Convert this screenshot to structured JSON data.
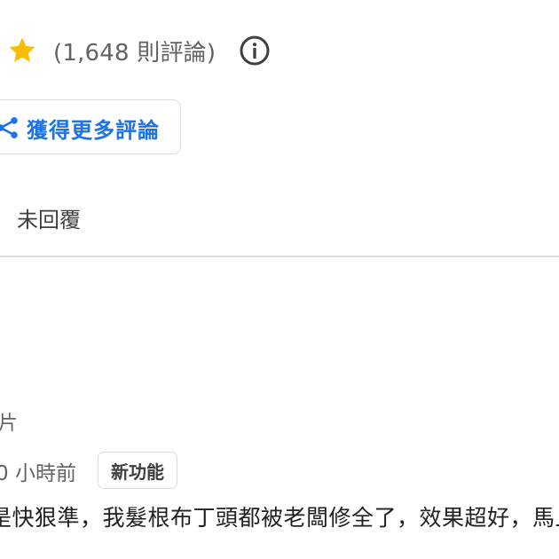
{
  "rating": {
    "review_count": "(1,648 則評論)",
    "star_color": "#fbbc04"
  },
  "actions": {
    "more_reviews_label": "獲得更多評論",
    "accent_color": "#1a73e8",
    "icon": "share-icon"
  },
  "filter": {
    "tab_label": "未回覆"
  },
  "review": {
    "photos_count": "片",
    "time": "0 小時前",
    "badge": "新功能",
    "text": "是快狠準，我髮根布丁頭都被老闆修全了，效果超好，馬上"
  },
  "icons": [
    "star-icon",
    "info-icon",
    "share-icon"
  ]
}
